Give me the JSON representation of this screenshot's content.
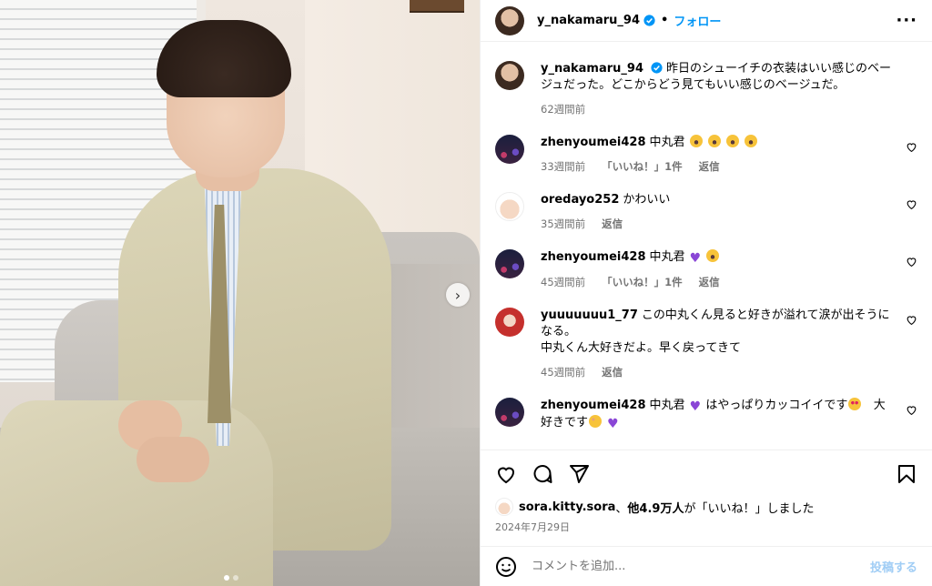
{
  "header": {
    "username": "y_nakamaru_94",
    "follow_label": "フォロー",
    "separator": "•"
  },
  "caption": {
    "username": "y_nakamaru_94",
    "text": "昨日のシューイチの衣装はいい感じのベージュだった。どこからどう見てもいい感じのベージュだ。",
    "time": "62週間前"
  },
  "comments": [
    {
      "username": "zhenyoumei428",
      "text": "中丸君",
      "emoji": [
        "scream",
        "scream",
        "scream",
        "scream"
      ],
      "time": "33週間前",
      "likes": "「いいね！」1件",
      "reply": "返信"
    },
    {
      "username": "oredayo252",
      "text": "かわいい",
      "emoji": [],
      "time": "35週間前",
      "likes": "",
      "reply": "返信"
    },
    {
      "username": "zhenyoumei428",
      "text": "中丸君",
      "emoji": [
        "purple-heart",
        "scream"
      ],
      "time": "45週間前",
      "likes": "「いいね！」1件",
      "reply": "返信"
    },
    {
      "username": "yuuuuuuu1_77",
      "text": "この中丸くん見ると好きが溢れて涙が出そうになる。",
      "text2": "中丸くん大好きだよ。早く戻ってきて",
      "time": "45週間前",
      "reply": "返信"
    },
    {
      "username": "zhenyoumei428",
      "text_a": "中丸君",
      "text_b": "はやっぱりカッコイイです",
      "text_c": "大好きです"
    }
  ],
  "likes": {
    "user": "sora.kitty.sora",
    "sep": "、",
    "others": "他4.9万人",
    "suffix": "が「いいね！」しました"
  },
  "date": "2024年7月29日",
  "add_comment": {
    "placeholder": "コメントを追加...",
    "post_label": "投稿する"
  },
  "icons": [
    "heart-icon",
    "comment-icon",
    "share-icon",
    "bookmark-icon",
    "emoji-icon",
    "more-icon",
    "verified-icon",
    "chevron-right-icon"
  ]
}
